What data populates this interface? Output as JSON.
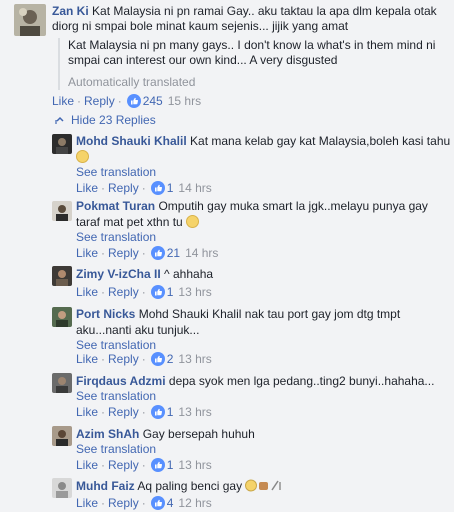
{
  "top_comment": {
    "author": "Zan Ki",
    "text": "Kat Malaysia ni pn ramai Gay.. aku taktau la apa dlm kepala otak diorg ni smpai bole minat kaum sejenis... jijik yang amat",
    "translation": "Kat Malaysia ni pn many gays.. I don't know la what's in them mind ni smpai can interest our own kind... A very disgusted",
    "translation_note": "Automatically translated",
    "like_label": "Like",
    "reply_label": "Reply",
    "reactions": "245",
    "time": "15 hrs"
  },
  "hide_replies_label": "Hide 23 Replies",
  "replies": [
    {
      "author": "Mohd Shauki Khalil",
      "text": "Kat mana kelab gay kat Malaysia,boleh kasi tahu",
      "see_translation": "See translation",
      "like_label": "Like",
      "reply_label": "Reply",
      "reactions": "1",
      "time": "14 hrs"
    },
    {
      "author": "Pokmat Turan",
      "text": "Omputih gay muka smart la jgk..melayu punya gay taraf mat pet xthn tu",
      "see_translation": "See translation",
      "like_label": "Like",
      "reply_label": "Reply",
      "reactions": "21",
      "time": "14 hrs"
    },
    {
      "author": "Zimy V-izCha II",
      "text": "^ ahhaha",
      "like_label": "Like",
      "reply_label": "Reply",
      "reactions": "1",
      "time": "13 hrs"
    },
    {
      "author": "Port Nicks",
      "text": "Mohd Shauki Khalil nak tau port gay jom dtg tmpt aku...nanti aku tunjuk...",
      "see_translation": "See translation",
      "like_label": "Like",
      "reply_label": "Reply",
      "reactions": "2",
      "time": "13 hrs"
    },
    {
      "author": "Firqdaus Adzmi",
      "text": "depa syok men lga pedang..ting2 bunyi..hahaha...",
      "see_translation": "See translation",
      "like_label": "Like",
      "reply_label": "Reply",
      "reactions": "1",
      "time": "13 hrs"
    },
    {
      "author": "Azim ShAh",
      "text": "Gay bersepah huhuh",
      "see_translation": "See translation",
      "like_label": "Like",
      "reply_label": "Reply",
      "reactions": "1",
      "time": "13 hrs"
    },
    {
      "author": "Muhd Faiz",
      "text": "Aq paling benci gay",
      "like_label": "Like",
      "reply_label": "Reply",
      "reactions": "4",
      "time": "12 hrs"
    }
  ]
}
